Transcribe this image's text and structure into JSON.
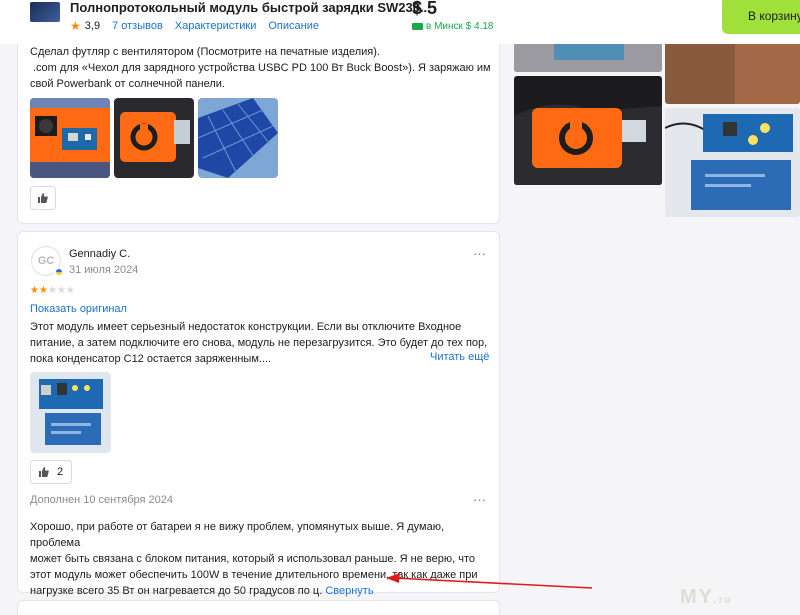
{
  "header": {
    "product_title": "Полнопротокольный модуль быстрой зарядки SW230...",
    "rating": "3,9",
    "reviews_link": "7 отзывов",
    "specs_link": "Характеристики",
    "description_link": "Описание",
    "price": "$ 5",
    "delivery": "в Минск $ 4.18",
    "cart_button": "В корзину"
  },
  "reviews": [
    {
      "text_line1": "Сделал футляр с вентилятором (Посмотрите на печатные изделия).",
      "text_line2": ".com для «Чехол для зарядного устройства USBC PD 100 Вт Buck Boost»). Я заряжаю им",
      "text_line3": "свой Powerbank от солнечной панели."
    },
    {
      "avatar_initials": "GC",
      "author": "Gennadiy C.",
      "date": "31 июля 2024",
      "rating": 2,
      "stars": [
        "★",
        "★",
        "★",
        "★",
        "★"
      ],
      "show_original": "Показать оригинал",
      "text_line1": "Этот модуль имеет серьезный недостаток конструкции. Если вы отключите Входное",
      "text_line2": "питание, а затем подключите его снова, модуль не перезагрузится. Это будет до тех пор,",
      "text_line3": "пока конденсатор C12 остается заряженным....",
      "read_more": "Читать ещё",
      "likes": "2",
      "supplement_date": "Дополнен 10 сентября 2024",
      "supplement_line1": "Хорошо, при работе от батареи я не вижу проблем, упомянутых выше. Я думаю, проблема",
      "supplement_line2": "может быть связана с блоком питания, который я использовал раньше. Я не верю, что",
      "supplement_line3": "этот модуль может обеспечить 100W в течение длительного времени, так как даже при",
      "supplement_line4": "нагрузке всего 35 Вт он нагревается до 50 градусов по ц.",
      "collapse": "Свернуть"
    }
  ],
  "watermark": "MY",
  "watermark_suffix": ".ru",
  "more_menu": "···",
  "colors": {
    "accent": "#1d72c9",
    "star": "#ff8a00",
    "cart": "#9fe03a",
    "delivery": "#19a84a",
    "arrow": "#e0191f"
  }
}
